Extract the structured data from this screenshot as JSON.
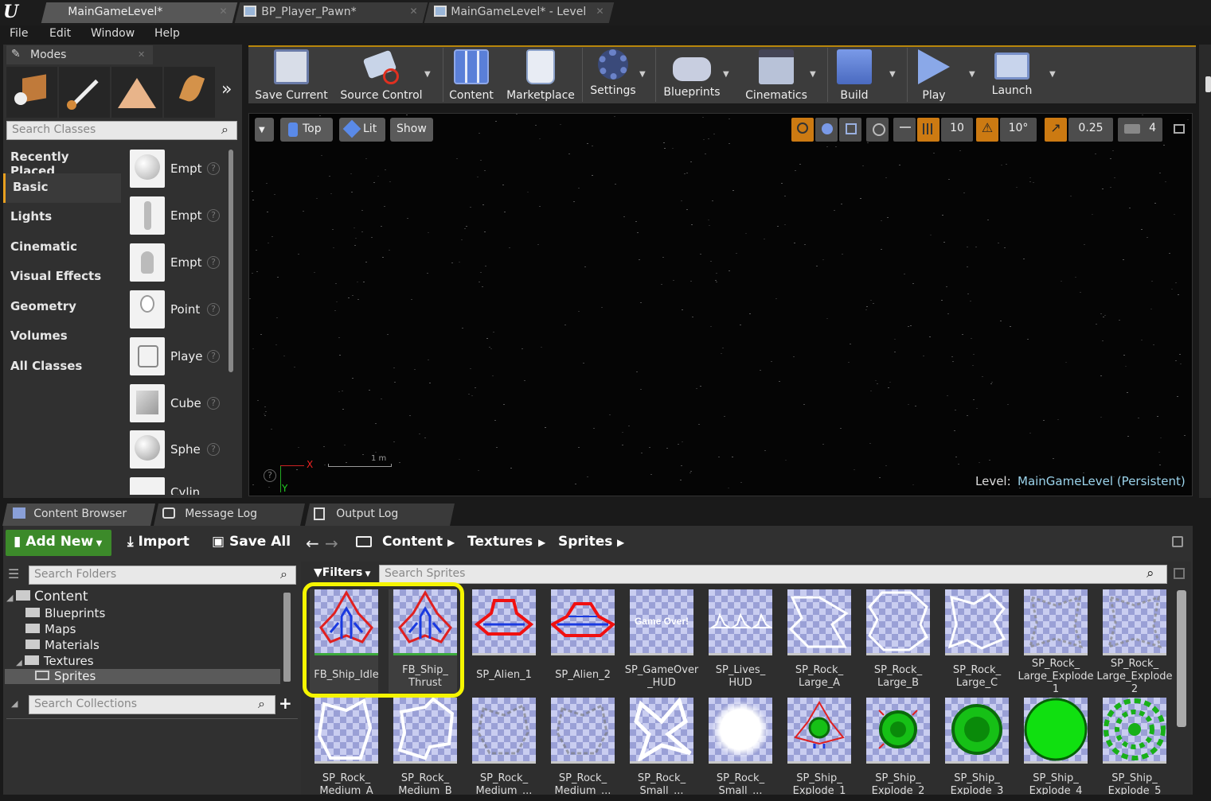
{
  "tabs": [
    {
      "label": "MainGameLevel*"
    },
    {
      "label": "BP_Player_Pawn*"
    },
    {
      "label": "MainGameLevel* - Level"
    }
  ],
  "menu": [
    "File",
    "Edit",
    "Window",
    "Help"
  ],
  "modes": {
    "tab_label": "Modes",
    "search_placeholder": "Search Classes",
    "categories": [
      "Recently Placed",
      "Basic",
      "Lights",
      "Cinematic",
      "Visual Effects",
      "Geometry",
      "Volumes",
      "All Classes"
    ],
    "selected_category": "Basic",
    "items": [
      "Empt",
      "Empt",
      "Empt",
      "Point",
      "Playe",
      "Cube",
      "Sphe",
      "Cylin"
    ]
  },
  "toolbar": {
    "buttons": [
      "Save Current",
      "Source Control",
      "Content",
      "Marketplace",
      "Settings",
      "Blueprints",
      "Cinematics",
      "Build",
      "Play",
      "Launch"
    ]
  },
  "viewport": {
    "view_label": "Top",
    "lit_label": "Lit",
    "show_label": "Show",
    "grid_snap": "10",
    "rot_snap": "10°",
    "scale_snap": "0.25",
    "camera_speed": "4",
    "axis_x": "X",
    "axis_y": "Y",
    "scale_label": "1 m",
    "level_prefix": "Level:",
    "level_name": "MainGameLevel (Persistent)"
  },
  "bottom_tabs": [
    "Content Browser",
    "Message Log",
    "Output Log"
  ],
  "content_browser": {
    "add_new": "Add New",
    "import": "Import",
    "save_all": "Save All",
    "breadcrumb": [
      "Content",
      "Textures",
      "Sprites"
    ],
    "search_folders_placeholder": "Search Folders",
    "filters_label": "Filters",
    "search_assets_placeholder": "Search Sprites",
    "search_collections_placeholder": "Search Collections",
    "tree": {
      "root": "Content",
      "children": [
        "Blueprints",
        "Maps",
        "Materials",
        "Textures"
      ],
      "textures_child": "Sprites"
    },
    "assets_row1": [
      "FB_Ship_Idle",
      "FB_Ship_\nThrust",
      "SP_Alien_1",
      "SP_Alien_2",
      "SP_GameOver\n_HUD",
      "SP_Lives_\nHUD",
      "SP_Rock_\nLarge_A",
      "SP_Rock_\nLarge_B",
      "SP_Rock_\nLarge_C",
      "SP_Rock_\nLarge_Explode\n1",
      "SP_Rock_\nLarge_Explode\n2"
    ],
    "assets_row2": [
      "SP_Rock_\nMedium_A",
      "SP_Rock_\nMedium_B",
      "SP_Rock_\nMedium_...",
      "SP_Rock_\nMedium_...",
      "SP_Rock_\nSmall_...",
      "SP_Rock_\nSmall_...",
      "SP_Ship_\nExplode_1",
      "SP_Ship_\nExplode_2",
      "SP_Ship_\nExplode_3",
      "SP_Ship_\nExplode_4",
      "SP_Ship_\nExplode_5"
    ],
    "game_over_text": "Game Over!",
    "highlight_color": "#f5f500"
  }
}
